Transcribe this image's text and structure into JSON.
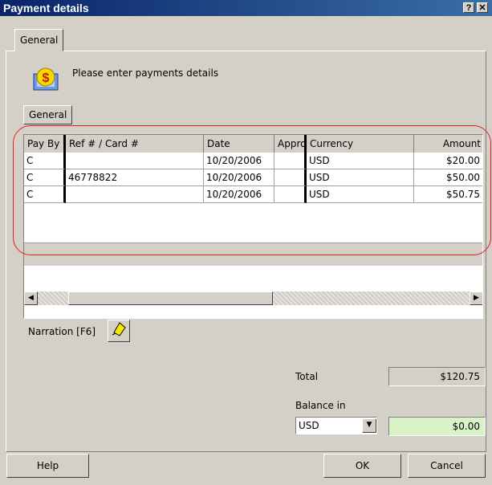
{
  "window": {
    "title": "Payment details",
    "help_btn": "?",
    "close_btn": "✕"
  },
  "tabs": {
    "outer": "General",
    "inner": "General"
  },
  "prompt": "Please enter payments details",
  "grid": {
    "columns": [
      "Pay By",
      "Ref # / Card #",
      "Date",
      "Appro",
      "Currency",
      "Amount"
    ],
    "rows": [
      {
        "pay_by": "C",
        "ref": "",
        "date": "10/20/2006",
        "appro": "",
        "currency": "USD",
        "amount": "$20.00"
      },
      {
        "pay_by": "C",
        "ref": "46778822",
        "date": "10/20/2006",
        "appro": "",
        "currency": "USD",
        "amount": "$50.00"
      },
      {
        "pay_by": "C",
        "ref": "",
        "date": "10/20/2006",
        "appro": "",
        "currency": "USD",
        "amount": "$50.75"
      }
    ]
  },
  "narration": {
    "label": "Narration [F6]"
  },
  "totals": {
    "total_label": "Total",
    "total_value": "$120.75",
    "balance_label": "Balance in",
    "balance_currency": "USD",
    "balance_value": "$0.00"
  },
  "buttons": {
    "help": "Help",
    "ok": "OK",
    "cancel": "Cancel"
  },
  "colors": {
    "title_start": "#0a246a",
    "title_end": "#3a6ea5",
    "balance_bg": "#d9f2c6",
    "highlight": "#e02020"
  }
}
